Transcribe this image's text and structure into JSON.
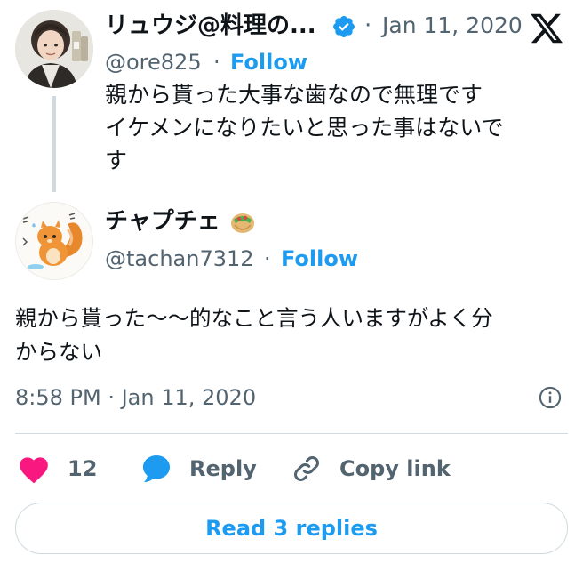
{
  "parent_tweet": {
    "display_name": "リュウジ@料理の...",
    "handle": "@ore825",
    "separator": "·",
    "follow_label": "Follow",
    "date": "Jan 11, 2020",
    "text_lines": [
      "親から貰った大事な歯なので無理です",
      "イケメンになりたいと思った事はないで",
      "す"
    ],
    "verified": true
  },
  "main_tweet": {
    "display_name": "チャプチェ",
    "name_emoji": "🥙",
    "handle": "@tachan7312",
    "separator": "·",
    "follow_label": "Follow",
    "text_lines": [
      "親から貰った〜〜的なこと言う人いますがよく分",
      "からない"
    ],
    "timestamp": "8:58 PM · Jan 11, 2020"
  },
  "actions": {
    "like_count": "12",
    "reply_label": "Reply",
    "copy_link_label": "Copy link"
  },
  "read_replies_label": "Read 3 replies",
  "colors": {
    "accent": "#1d9bf0",
    "like": "#f91880",
    "text": "#0f1419",
    "muted": "#536471",
    "border": "#cfd9de"
  }
}
